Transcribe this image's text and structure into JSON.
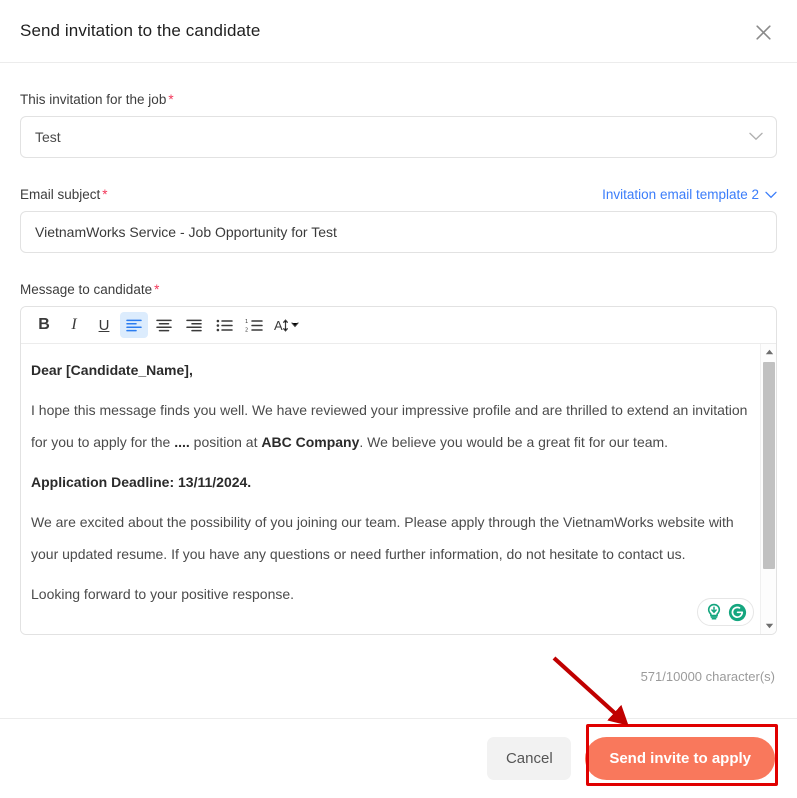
{
  "dialog": {
    "title": "Send invitation to the candidate",
    "close_icon": "close-icon"
  },
  "job_field": {
    "label": "This invitation for the job",
    "required_mark": "*",
    "value": "Test"
  },
  "subject_field": {
    "label": "Email subject",
    "required_mark": "*",
    "value": "VietnamWorks Service - Job Opportunity for Test",
    "placeholder": "Email subject",
    "template_link": "Invitation email template 2"
  },
  "message_field": {
    "label": "Message to candidate",
    "required_mark": "*",
    "toolbar": [
      {
        "name": "bold-button",
        "label": "B",
        "active": false
      },
      {
        "name": "italic-button",
        "label": "I",
        "active": false
      },
      {
        "name": "underline-button",
        "label": "U",
        "active": false
      },
      {
        "name": "align-left-button",
        "label": "",
        "active": true
      },
      {
        "name": "align-center-button",
        "label": "",
        "active": false
      },
      {
        "name": "align-right-button",
        "label": "",
        "active": false
      },
      {
        "name": "bullet-list-button",
        "label": "",
        "active": false
      },
      {
        "name": "numbered-list-button",
        "label": "",
        "active": false
      },
      {
        "name": "font-size-button",
        "label": "",
        "active": false
      }
    ],
    "body": {
      "greeting": "Dear [Candidate_Name],",
      "para1_part1": "I hope this message finds you well. We have reviewed your impressive profile and are thrilled to extend an invitation for you to apply for the ",
      "para1_ellipsis": "....",
      "para1_part2": " position at ",
      "para1_company": "ABC Company",
      "para1_part3": ". We believe you would be a great fit for our team.",
      "deadline": "Application Deadline: 13/11/2024.",
      "para2": "We are excited about the possibility of you joining our team. Please apply through the VietnamWorks website with your updated resume. If you have any questions or need further information, do not hesitate to contact us.",
      "para3": "Looking forward to your positive response."
    },
    "grammarly": {
      "bulb_icon": "lightbulb-icon",
      "logo_icon": "grammarly-logo-icon"
    },
    "char_count": "571/10000 character(s)"
  },
  "footer": {
    "cancel_label": "Cancel",
    "send_label": "Send invite to apply"
  },
  "colors": {
    "accent": "#f9785c",
    "link": "#3b7dfa",
    "required": "#f2385a",
    "annotation": "#e00000",
    "toolbar_active_bg": "#dcecfd",
    "toolbar_active_fg": "#2b7cf0",
    "grammarly_green": "#15a67f"
  }
}
